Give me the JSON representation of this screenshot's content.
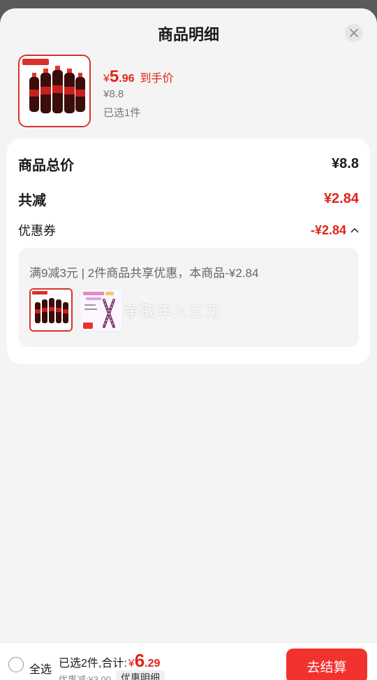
{
  "sheet": {
    "title": "商品明细"
  },
  "product": {
    "price_symbol": "¥",
    "price_int": "5",
    "price_dec": ".96",
    "price_label": "到手价",
    "original_price": "¥8.8",
    "selected_text": "已选1件"
  },
  "breakdown": {
    "total_label": "商品总价",
    "total_value": "¥8.8",
    "reduce_label": "共减",
    "reduce_value": "¥2.84",
    "coupon_label": "优惠券",
    "coupon_value": "-¥2.84",
    "coupon_desc": "满9减3元 | 2件商品共享优惠，本商品-¥2.84",
    "watermark": "争取年入三万"
  },
  "bottom": {
    "select_all": "全选",
    "summary_prefix": "已选2件,合计:",
    "total_symbol": "¥",
    "total_int": "6",
    "total_dec": ".29",
    "discount_text": "优惠减:¥3.00",
    "detail_label": "优惠明细",
    "checkout_label": "去结算"
  },
  "colors": {
    "accent": "#e2231a",
    "button": "#f2322e",
    "background": "#f4f4f4"
  },
  "icons": [
    "close-icon",
    "chevron-up-icon",
    "checkbox-circle-icon"
  ]
}
